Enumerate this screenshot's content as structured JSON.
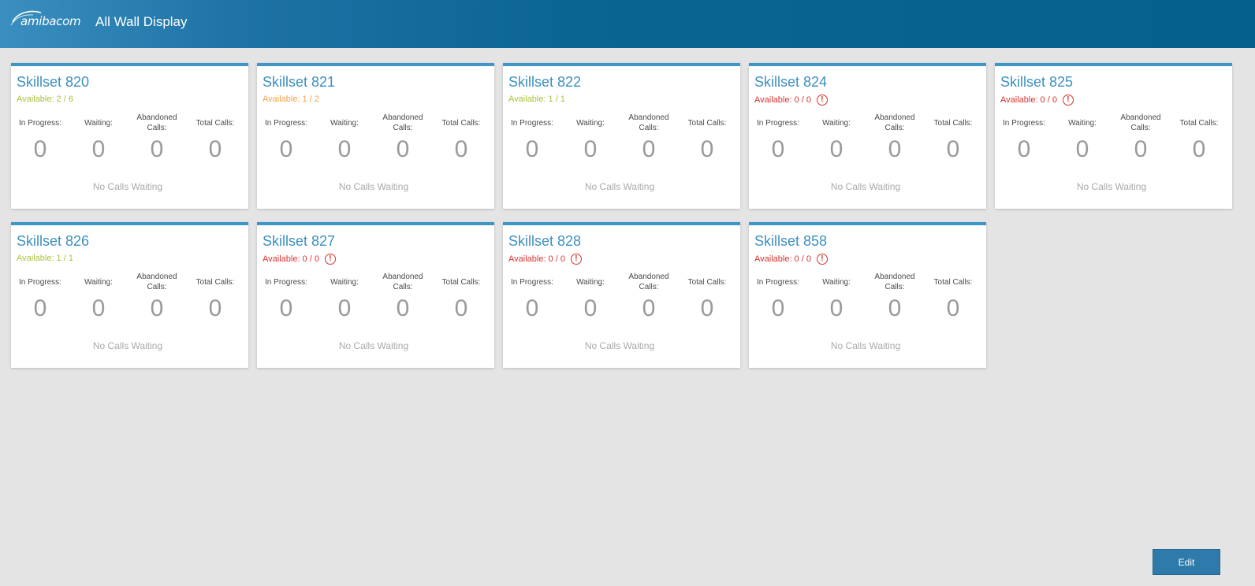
{
  "header": {
    "logo_text": "amibacom",
    "title": "All Wall Display"
  },
  "stat_labels": {
    "in_progress": "In Progress:",
    "waiting": "Waiting:",
    "abandoned": "Abandoned Calls:",
    "total": "Total Calls:"
  },
  "colors": {
    "accent": "#3d96c7",
    "header": "#05608e",
    "available_good": "#a8c23a",
    "available_warn": "#f3a24a",
    "available_bad": "#d9322f"
  },
  "skillsets": [
    {
      "title": "Skillset 820",
      "available": "Available: 2 / 6",
      "status": "good",
      "alert": false,
      "in_progress": "0",
      "waiting": "0",
      "abandoned": "0",
      "total": "0",
      "message": "No Calls Waiting"
    },
    {
      "title": "Skillset 821",
      "available": "Available: 1 / 2",
      "status": "warn",
      "alert": false,
      "in_progress": "0",
      "waiting": "0",
      "abandoned": "0",
      "total": "0",
      "message": "No Calls Waiting"
    },
    {
      "title": "Skillset 822",
      "available": "Available: 1 / 1",
      "status": "good",
      "alert": false,
      "in_progress": "0",
      "waiting": "0",
      "abandoned": "0",
      "total": "0",
      "message": "No Calls Waiting"
    },
    {
      "title": "Skillset 824",
      "available": "Available: 0 / 0",
      "status": "bad",
      "alert": true,
      "in_progress": "0",
      "waiting": "0",
      "abandoned": "0",
      "total": "0",
      "message": "No Calls Waiting"
    },
    {
      "title": "Skillset 825",
      "available": "Available: 0 / 0",
      "status": "bad",
      "alert": true,
      "in_progress": "0",
      "waiting": "0",
      "abandoned": "0",
      "total": "0",
      "message": "No Calls Waiting"
    },
    {
      "title": "Skillset 826",
      "available": "Available: 1 / 1",
      "status": "good",
      "alert": false,
      "in_progress": "0",
      "waiting": "0",
      "abandoned": "0",
      "total": "0",
      "message": "No Calls Waiting"
    },
    {
      "title": "Skillset 827",
      "available": "Available: 0 / 0",
      "status": "bad",
      "alert": true,
      "in_progress": "0",
      "waiting": "0",
      "abandoned": "0",
      "total": "0",
      "message": "No Calls Waiting"
    },
    {
      "title": "Skillset 828",
      "available": "Available: 0 / 0",
      "status": "bad",
      "alert": true,
      "in_progress": "0",
      "waiting": "0",
      "abandoned": "0",
      "total": "0",
      "message": "No Calls Waiting"
    },
    {
      "title": "Skillset 858",
      "available": "Available: 0 / 0",
      "status": "bad",
      "alert": true,
      "in_progress": "0",
      "waiting": "0",
      "abandoned": "0",
      "total": "0",
      "message": "No Calls Waiting"
    }
  ],
  "footer": {
    "edit_label": "Edit"
  }
}
